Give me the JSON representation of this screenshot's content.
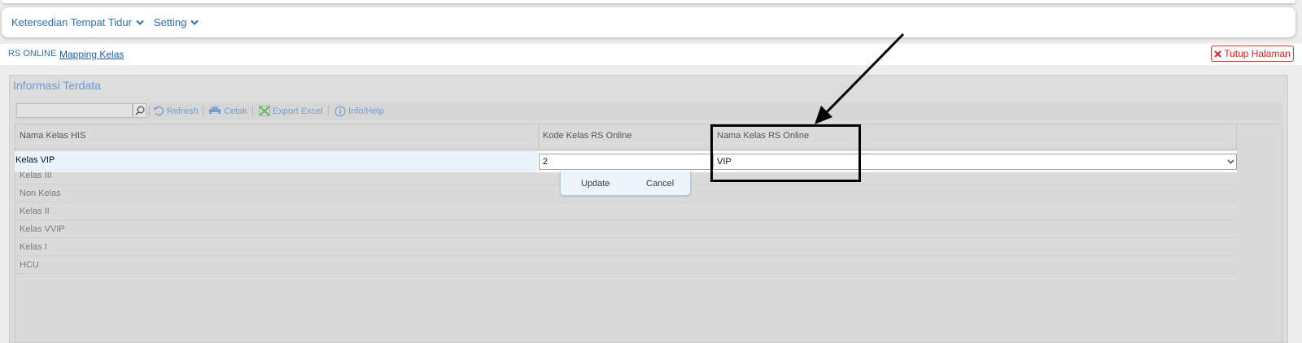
{
  "nav": {
    "items": [
      {
        "label": "Ketersedian Tempat Tidur"
      },
      {
        "label": "Setting"
      }
    ]
  },
  "breadcrumb": {
    "parent": "RS ONLINE",
    "current": "Mapping Kelas"
  },
  "close_button": {
    "label": "Tutup Halaman"
  },
  "panel": {
    "title": "Informasi Terdata"
  },
  "toolbar": {
    "search_placeholder": "",
    "refresh": "Refresh",
    "print": "Cetak",
    "export": "Export Excel",
    "info": "Info/Help"
  },
  "grid": {
    "columns": [
      "Nama Kelas HIS",
      "Kode Kelas RS Online",
      "Nama Kelas RS Online"
    ],
    "edit_row": {
      "nama_kelas_his": "Kelas VIP",
      "kode": "2",
      "nama_rs_online": "VIP"
    },
    "actions": {
      "update": "Update",
      "cancel": "Cancel"
    },
    "rows": [
      "Kelas III",
      "Non Kelas",
      "Kelas II",
      "Kelas VVIP",
      "Kelas I",
      "HCU"
    ]
  },
  "colors": {
    "accent": "#2f6fb3",
    "danger": "#d22222",
    "annotation": "#000000"
  }
}
